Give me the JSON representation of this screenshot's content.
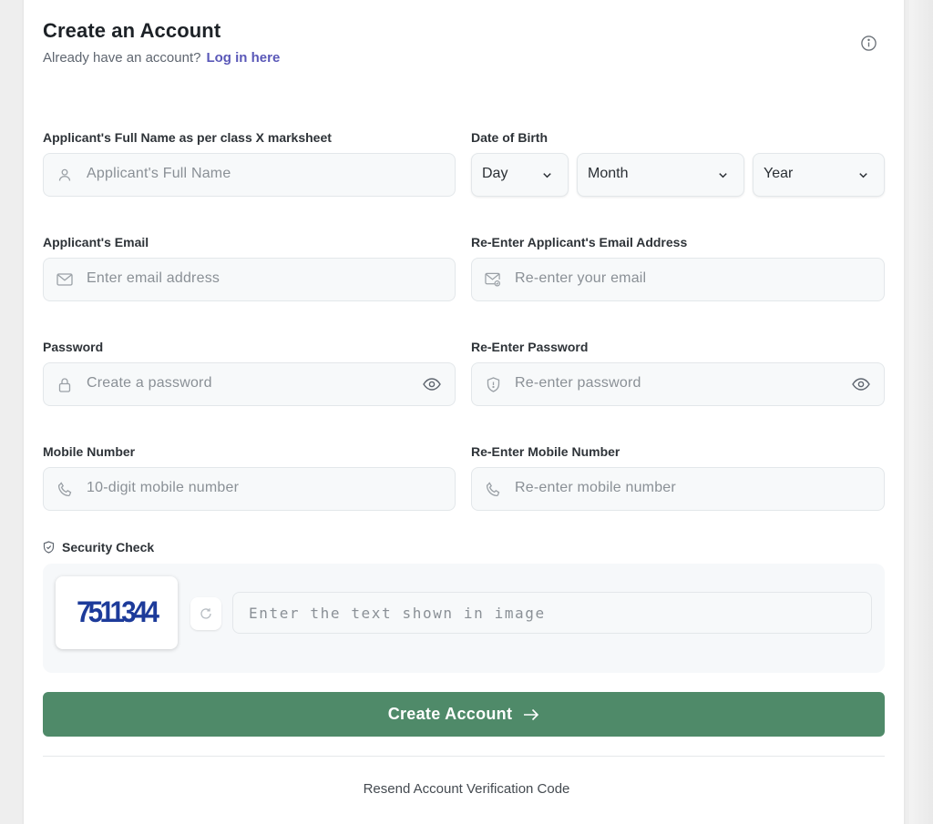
{
  "header": {
    "title": "Create an Account",
    "subtitle": "Already have an account?",
    "login_link": "Log in here"
  },
  "form": {
    "full_name": {
      "label": "Applicant's Full Name as per class X marksheet",
      "placeholder": "Applicant's Full Name",
      "icon": "user-icon"
    },
    "dob": {
      "label": "Date of Birth",
      "day": "Day",
      "month": "Month",
      "year": "Year"
    },
    "email": {
      "label": "Applicant's Email",
      "placeholder": "Enter email address",
      "icon": "mail-icon"
    },
    "email_confirm": {
      "label": "Re-Enter Applicant's Email Address",
      "placeholder": "Re-enter your email",
      "icon": "mail-check-icon"
    },
    "password": {
      "label": "Password",
      "placeholder": "Create a password",
      "icon": "lock-icon"
    },
    "password_confirm": {
      "label": "Re-Enter Password",
      "placeholder": "Re-enter password",
      "icon": "shield-icon"
    },
    "mobile": {
      "label": "Mobile Number",
      "placeholder": "10-digit mobile number",
      "icon": "phone-icon"
    },
    "mobile_confirm": {
      "label": "Re-Enter Mobile Number",
      "placeholder": "Re-enter mobile number",
      "icon": "phone-icon"
    }
  },
  "security": {
    "label": "Security Check",
    "captcha_text": "7511344",
    "input_placeholder": "Enter the text shown in image"
  },
  "actions": {
    "submit_label": "Create Account",
    "resend_label": "Resend Account Verification Code"
  },
  "colors": {
    "primary": "#4f8a69",
    "link": "#5a58b8",
    "captcha_ink": "#1d3b9a"
  }
}
